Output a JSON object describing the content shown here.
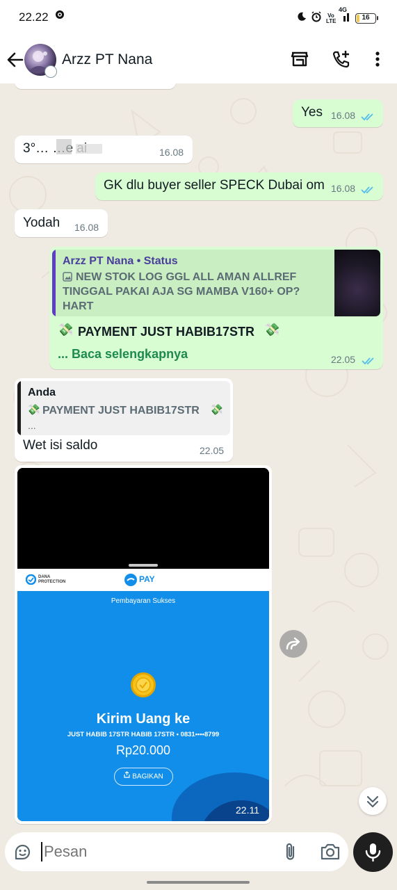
{
  "status_bar": {
    "time": "22.22",
    "volte_label": "Vo\nLTE",
    "network": "4G",
    "battery": "16",
    "battery_level": 0.16
  },
  "header": {
    "contact_name": "Arzz PT Nana",
    "icons": [
      "back-arrow-icon",
      "store-icon",
      "add-call-icon",
      "more-vert-icon"
    ]
  },
  "messages": [
    {
      "dir": "out",
      "text": "Yes",
      "time": "16.08",
      "status": "read"
    },
    {
      "dir": "in",
      "text": "3°… …e ai",
      "time": "16.08",
      "obscured": true
    },
    {
      "dir": "out",
      "text": "GK dlu buyer seller SPECK Dubai om",
      "time": "16.08",
      "status": "read"
    },
    {
      "dir": "in",
      "text": "Yodah",
      "time": "16.08"
    },
    {
      "dir": "out",
      "quote": {
        "author": "Arzz PT Nana • Status",
        "text": "NEW STOK LOG GGL ALL AMAN ALLREF TINGGAL PAKAI AJA SG MAMBA V160+ OP? HART"
      },
      "text": "PAYMENT JUST HABIB17STR",
      "read_more": "... Baca selengkapnya",
      "time": "22.05",
      "status": "read"
    },
    {
      "dir": "in",
      "quote": {
        "author": "Anda",
        "text": "PAYMENT JUST HABIB17STR",
        "more": "..."
      },
      "text": "Wet isi saldo",
      "time": "22.05"
    },
    {
      "dir": "in",
      "type": "image",
      "time": "22.11",
      "image": {
        "brand": "DANA\nPROTECTION",
        "pay_label": "PAY",
        "status": "Pembayaran Sukses",
        "title": "Kirim Uang ke",
        "recipient": "JUST HABIB 17STR HABIB 17STR • 0831••••8799",
        "amount": "Rp20.000",
        "share_label": "BAGIKAN"
      }
    }
  ],
  "composer": {
    "placeholder": "Pesan",
    "icons": [
      "sticker-icon",
      "attach-icon",
      "camera-icon",
      "mic-icon"
    ]
  },
  "colors": {
    "outgoing_bubble": "#d9fdd3",
    "incoming_bubble": "#ffffff",
    "chat_bg": "#efeae2",
    "read_ticks": "#53bdeb",
    "accent_green": "#1fa855",
    "dana_blue": "#118ee9"
  }
}
